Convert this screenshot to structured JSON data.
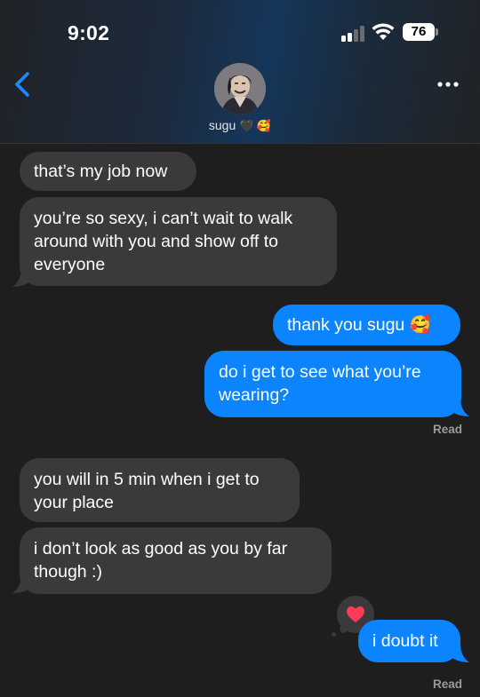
{
  "status_bar": {
    "time": "9:02",
    "battery": "76"
  },
  "header": {
    "contact_name": "sugu",
    "contact_emojis": "🖤 🥰"
  },
  "messages": [
    {
      "dir": "in",
      "text": "that’s my job now"
    },
    {
      "dir": "in",
      "text": "you’re so sexy, i can’t wait to walk around with you and show off to everyone"
    },
    {
      "dir": "out",
      "text": "thank you sugu 🥰"
    },
    {
      "dir": "out",
      "text": "do i get to see what you’re wearing?"
    },
    {
      "dir": "in",
      "text": "you will in 5 min when i get to your place"
    },
    {
      "dir": "in",
      "text": "i don’t look as good as you by far though :)"
    },
    {
      "dir": "out",
      "text": "i doubt it"
    }
  ],
  "receipts": [
    "Read",
    "Read"
  ],
  "tapback": {
    "icon": "heart-icon",
    "color": "#ff3b57"
  },
  "colors": {
    "incoming_bubble": "#3a3a3c",
    "outgoing_bubble": "#0b84fe",
    "background": "#1e1e1e"
  }
}
